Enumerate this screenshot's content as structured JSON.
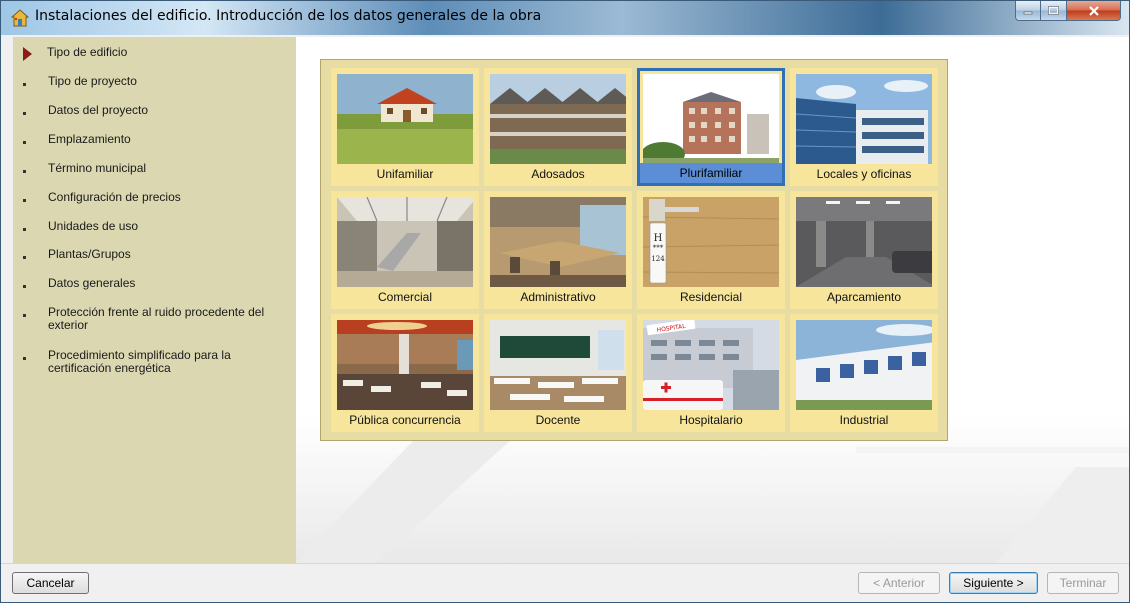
{
  "window": {
    "title": "Instalaciones del edificio. Introducción de los datos generales de la obra",
    "controls": [
      "minimize-icon",
      "maximize-icon",
      "close-icon"
    ]
  },
  "sidebar": {
    "items": [
      {
        "label": "Tipo de edificio",
        "active": true
      },
      {
        "label": "Tipo de proyecto"
      },
      {
        "label": "Datos del proyecto"
      },
      {
        "label": "Emplazamiento"
      },
      {
        "label": "Término municipal"
      },
      {
        "label": "Configuración de precios"
      },
      {
        "label": "Unidades de uso"
      },
      {
        "label": "Plantas/Grupos"
      },
      {
        "label": "Datos generales"
      },
      {
        "label": "Protección frente al ruido procedente del exterior"
      },
      {
        "label": "Procedimiento simplificado para la certificación energética"
      }
    ]
  },
  "building_types": [
    {
      "label": "Unifamiliar"
    },
    {
      "label": "Adosados"
    },
    {
      "label": "Plurifamiliar",
      "selected": true
    },
    {
      "label": "Locales y oficinas"
    },
    {
      "label": "Comercial"
    },
    {
      "label": "Administrativo"
    },
    {
      "label": "Residencial"
    },
    {
      "label": "Aparcamiento"
    },
    {
      "label": "Pública concurrencia"
    },
    {
      "label": "Docente"
    },
    {
      "label": "Hospitalario"
    },
    {
      "label": "Industrial"
    }
  ],
  "hotel_sign": {
    "letter": "H",
    "stars": "***",
    "number": "124"
  },
  "hospital_sign": "HOSPITAL",
  "footer": {
    "cancel": "Cancelar",
    "prev": "< Anterior",
    "next": "Siguiente >",
    "finish": "Terminar"
  },
  "colors": {
    "sidebar_bg": "#dbd7b1",
    "panel_bg": "#e7dca4",
    "tile_bg": "#f6e59a",
    "selection": "#2f6fb3",
    "active_arrow": "#8b1a1a"
  }
}
